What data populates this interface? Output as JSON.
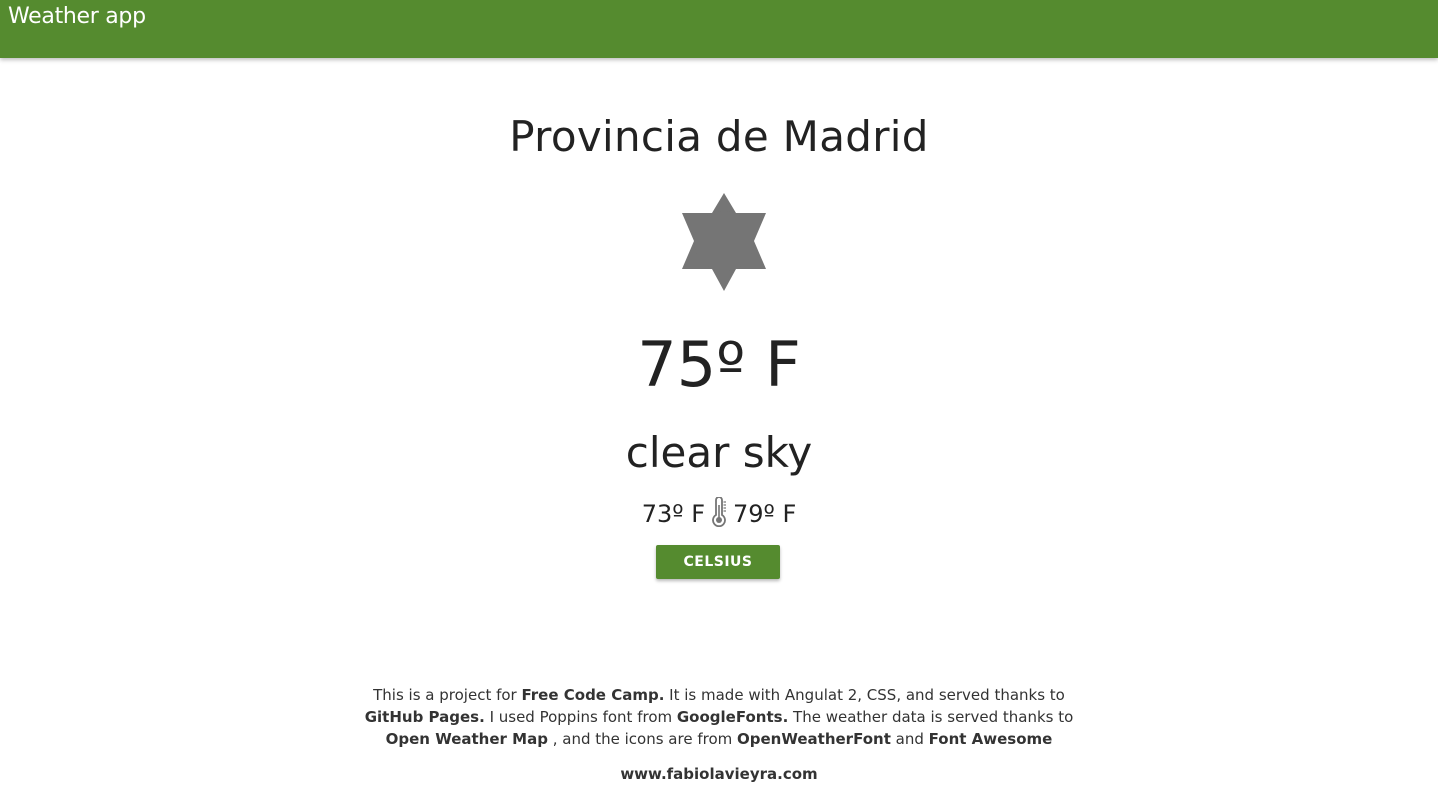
{
  "header": {
    "title": "Weather app"
  },
  "weather": {
    "city": "Provincia de Madrid",
    "icon": "sun-icon",
    "temperature": "75º F",
    "description": "clear sky",
    "min_temp": "73º F",
    "max_temp": "79º F",
    "range_icon": "thermometer-icon"
  },
  "actions": {
    "unit_toggle_label": "CELSIUS"
  },
  "footer": {
    "t1": "This is a project for ",
    "b1": "Free Code Camp.",
    "t2": " It is made with Angulat 2, CSS, and served thanks to ",
    "b2": "GitHub Pages.",
    "t3": " I used Poppins font from ",
    "b3": "GoogleFonts.",
    "t4": " The weather data is served thanks to ",
    "b4": "Open Weather Map",
    "t5": " , and the icons are from ",
    "b5": "OpenWeatherFont",
    "t6": " and ",
    "b6": "Font Awesome",
    "website": "www.fabiolavieyra.com"
  },
  "colors": {
    "primary": "#558b2f",
    "icon_gray": "#757575",
    "text": "#222222"
  }
}
